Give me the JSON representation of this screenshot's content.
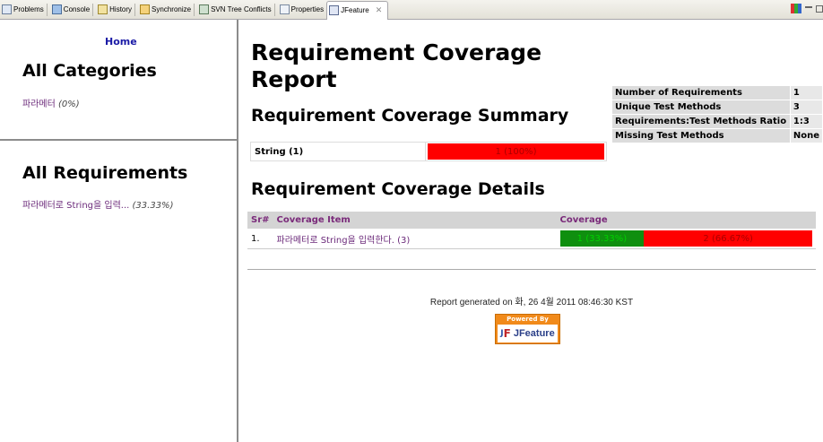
{
  "tabs": [
    {
      "label": "Problems",
      "icon": "problems-icon"
    },
    {
      "label": "Console",
      "icon": "console-icon"
    },
    {
      "label": "History",
      "icon": "history-icon"
    },
    {
      "label": "Synchronize",
      "icon": "synchronize-icon"
    },
    {
      "label": "SVN Tree Conflicts",
      "icon": "svn-tree-conflicts-icon"
    },
    {
      "label": "Properties",
      "icon": "properties-icon"
    },
    {
      "label": "JFeature",
      "icon": "jfeature-icon",
      "active": true
    }
  ],
  "sidebar": {
    "home_link": "Home",
    "categories_heading": "All Categories",
    "category_item": {
      "label": "파라메터",
      "pct": "(0%)"
    },
    "requirements_heading": "All Requirements",
    "requirement_item": {
      "label": "파라메터로 String을 입력...",
      "pct": "(33.33%)"
    }
  },
  "report": {
    "title": "Requirement Coverage Report",
    "summary_heading": "Requirement Coverage Summary",
    "summary_row": {
      "label": "String (1)",
      "bar_text": "1 (100%)",
      "coverage_fraction": 1.0
    },
    "stats": [
      {
        "label": "Number of Requirements",
        "value": "1"
      },
      {
        "label": "Unique Test Methods",
        "value": "3"
      },
      {
        "label": "Requirements:Test Methods Ratio",
        "value": "1:3"
      },
      {
        "label": "Missing Test Methods",
        "value": "None"
      }
    ],
    "details_heading": "Requirement Coverage Details",
    "details_columns": [
      "Sr#",
      "Coverage Item",
      "Coverage"
    ],
    "details_rows": [
      {
        "sr": "1.",
        "item": "파라메터로 String을 입력한다. (3)",
        "covered": "1 (33.33%)",
        "uncovered": "2 (66.67%)",
        "covered_fraction": 0.3333
      }
    ],
    "generated": "Report generated on 화, 26 4월 2011 08:46:30 KST",
    "badge": {
      "powered_by": "Powered By",
      "name": "JFeature"
    }
  },
  "colors": {
    "covered": "#0f8f0f",
    "uncovered": "#ff0000",
    "link": "#6b2a7a",
    "home": "#1a1aa6",
    "badge": "#f18a1a"
  }
}
